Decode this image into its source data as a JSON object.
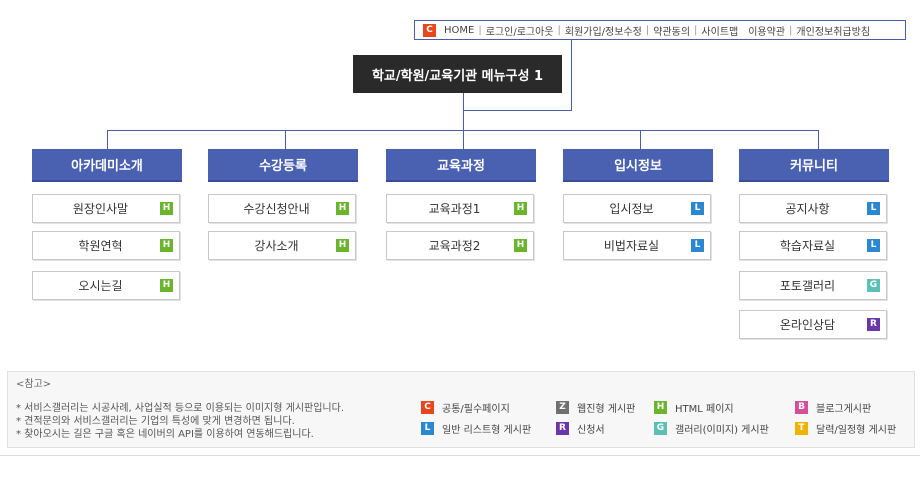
{
  "colors": {
    "C": "#e8461c",
    "H": "#6bb52e",
    "L": "#2a87d0",
    "G": "#5cc0b5",
    "R": "#6a37a8",
    "Z": "#707070",
    "B": "#d44f9a",
    "T": "#f0b400"
  },
  "topnav": {
    "badge": "C",
    "links": [
      "HOME",
      "로그인/로그아웃",
      "회원가입/정보수정",
      "약관동의",
      "사이트맵",
      "이용약관",
      "개인정보취급방침"
    ]
  },
  "title": "학교/학원/교육기관 메뉴구성 1",
  "categories": [
    {
      "label": "아카데미소개",
      "items": [
        {
          "label": "원장인사말",
          "type": "H"
        },
        {
          "label": "학원연혁",
          "type": "H"
        },
        {
          "label": "오시는길",
          "type": "H"
        }
      ]
    },
    {
      "label": "수강등록",
      "items": [
        {
          "label": "수강신청안내",
          "type": "H"
        },
        {
          "label": "강사소개",
          "type": "H"
        }
      ]
    },
    {
      "label": "교육과정",
      "items": [
        {
          "label": "교육과정1",
          "type": "H"
        },
        {
          "label": "교육과정2",
          "type": "H"
        }
      ]
    },
    {
      "label": "입시정보",
      "items": [
        {
          "label": "입시정보",
          "type": "L"
        },
        {
          "label": "비법자료실",
          "type": "L"
        }
      ]
    },
    {
      "label": "커뮤니티",
      "items": [
        {
          "label": "공지사항",
          "type": "L"
        },
        {
          "label": "학습자료실",
          "type": "L"
        },
        {
          "label": "포토갤러리",
          "type": "G"
        },
        {
          "label": "온라인상담",
          "type": "R"
        }
      ]
    }
  ],
  "notes": {
    "title": "<참고>",
    "lines": [
      "* 서비스갤러리는 시공사례, 사업실적 등으로 이용되는 이미지형 게시판입니다.",
      "* 견적문의와 서비스갤러리는 기업의 특성에 맞게 변경하면 됩니다.",
      "* 찾아오시는 길은 구글 혹은 네이버의 API를 이용하여 연동해드립니다."
    ]
  },
  "legend": [
    {
      "code": "C",
      "label": "공통/필수페이지"
    },
    {
      "code": "Z",
      "label": "웹진형 게시판"
    },
    {
      "code": "H",
      "label": "HTML 페이지"
    },
    {
      "code": "B",
      "label": "블로그게시판"
    },
    {
      "code": "L",
      "label": "일반 리스트형 게시판"
    },
    {
      "code": "R",
      "label": "신청서"
    },
    {
      "code": "G",
      "label": "갤러리(이미지) 게시판"
    },
    {
      "code": "T",
      "label": "달력/일정형 게시판"
    }
  ]
}
